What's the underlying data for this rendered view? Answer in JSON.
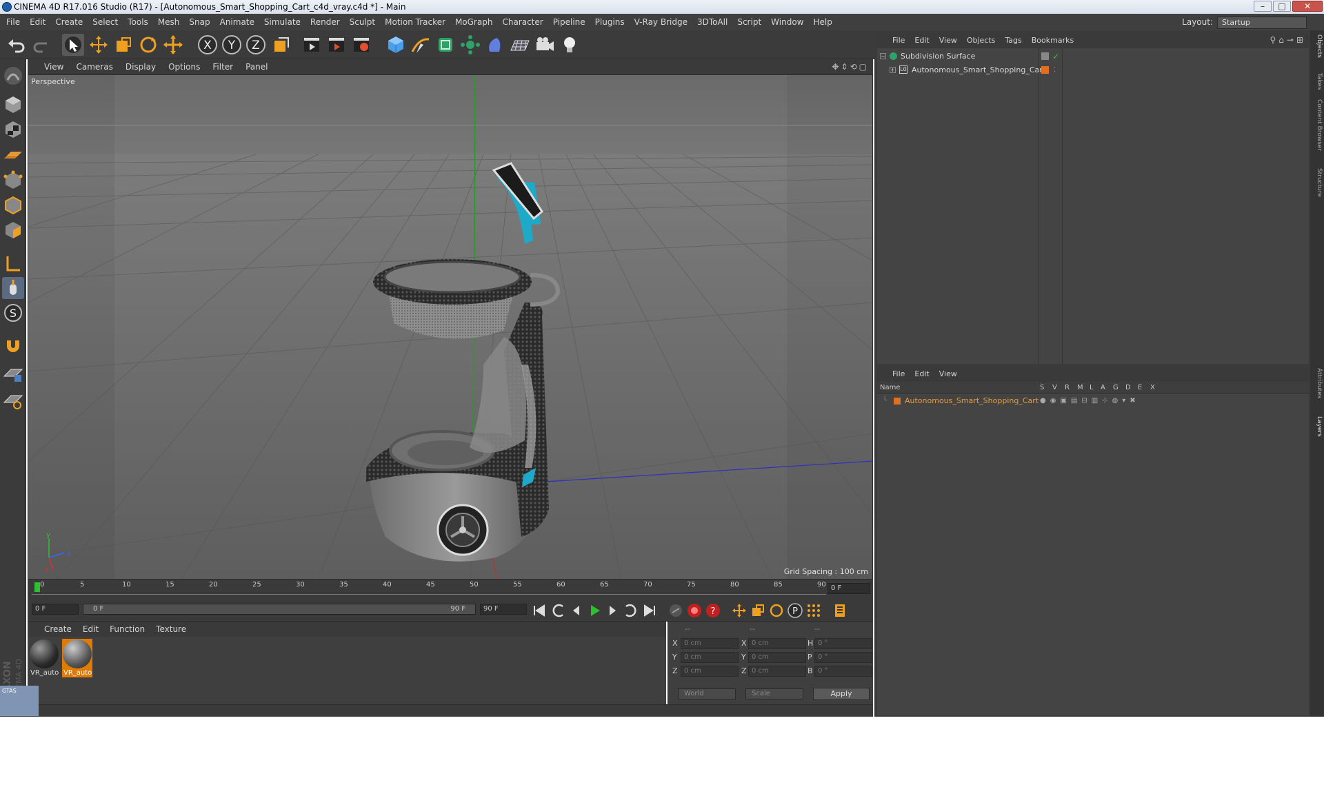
{
  "window": {
    "title": "CINEMA 4D R17.016 Studio (R17) - [Autonomous_Smart_Shopping_Cart_c4d_vray.c4d *] - Main",
    "min": "–",
    "max": "□",
    "close": "✕"
  },
  "menu": [
    "File",
    "Edit",
    "Create",
    "Select",
    "Tools",
    "Mesh",
    "Snap",
    "Animate",
    "Simulate",
    "Render",
    "Sculpt",
    "Motion Tracker",
    "MoGraph",
    "Character",
    "Pipeline",
    "Plugins",
    "V-Ray Bridge",
    "3DToAll",
    "Script",
    "Window",
    "Help"
  ],
  "layout": {
    "label": "Layout:",
    "value": "Startup"
  },
  "viewport": {
    "menu": [
      "View",
      "Cameras",
      "Display",
      "Options",
      "Filter",
      "Panel"
    ],
    "label": "Perspective",
    "grid_spacing": "Grid Spacing : 100 cm"
  },
  "timeline": {
    "ticks": [
      "0",
      "5",
      "10",
      "15",
      "20",
      "25",
      "30",
      "35",
      "40",
      "45",
      "50",
      "55",
      "60",
      "65",
      "70",
      "75",
      "80",
      "85",
      "90"
    ],
    "frame_end_label": "0 F",
    "current_frame": "0 F",
    "range_start": "0 F",
    "range_end_inner": "90 F",
    "range_end": "90 F"
  },
  "material_manager": {
    "menu": [
      "Create",
      "Edit",
      "Function",
      "Texture"
    ],
    "materials": [
      {
        "name": "VR_auto",
        "selected": false
      },
      {
        "name": "VR_auto",
        "selected": true
      }
    ]
  },
  "coordinates": {
    "headers": [
      "--",
      "--",
      "--"
    ],
    "rows": [
      {
        "axis": "X",
        "pos": "0 cm",
        "axis2": "X",
        "size": "0 cm",
        "rot_label": "H",
        "rot": "0 °"
      },
      {
        "axis": "Y",
        "pos": "0 cm",
        "axis2": "Y",
        "size": "0 cm",
        "rot_label": "P",
        "rot": "0 °"
      },
      {
        "axis": "Z",
        "pos": "0 cm",
        "axis2": "Z",
        "size": "0 cm",
        "rot_label": "B",
        "rot": "0 °"
      }
    ],
    "world": "World",
    "scale": "Scale",
    "apply": "Apply"
  },
  "objects": {
    "menu": [
      "File",
      "Edit",
      "View",
      "Objects",
      "Tags",
      "Bookmarks"
    ],
    "items": [
      {
        "name": "Subdivision Surface",
        "level": 0
      },
      {
        "name": "Autonomous_Smart_Shopping_Cart",
        "level": 1
      }
    ]
  },
  "layers": {
    "menu": [
      "File",
      "Edit",
      "View"
    ],
    "columns": [
      "Name",
      "S",
      "V",
      "R",
      "M",
      "L",
      "A",
      "G",
      "D",
      "E",
      "X"
    ],
    "items": [
      {
        "name": "Autonomous_Smart_Shopping_Cart"
      }
    ]
  },
  "side_tabs": [
    "Objects",
    "Takes",
    "Content Browser",
    "Structure",
    "Attributes",
    "Layers"
  ],
  "branding": {
    "maxon": "MAXON",
    "cinema": "CINEMA 4D",
    "badge": "GTAS"
  },
  "colors": {
    "accent_orange": "#f08a00",
    "layer_text": "#e89a3c",
    "cart_accent": "#1fa9c9"
  }
}
